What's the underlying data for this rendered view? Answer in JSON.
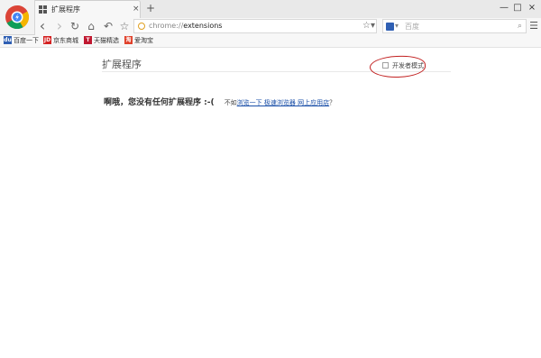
{
  "tab": {
    "title": "扩展程序",
    "close": "×"
  },
  "newtab": "+",
  "window": {
    "minimize": "—",
    "maximize": "□",
    "close": "×"
  },
  "nav": {
    "back": "‹",
    "forward": "›",
    "reload": "↻",
    "home": "⌂",
    "undo": "↶",
    "bookmark": "☆"
  },
  "address": {
    "prefix": "chrome://",
    "path": "extensions",
    "star": "☆▾"
  },
  "search": {
    "placeholder": "百度",
    "caret": "▾",
    "icon": "⌕"
  },
  "menu": "☰",
  "bookmarks": [
    {
      "icon": "du",
      "label": "百度一下",
      "color": "#2f5fb3"
    },
    {
      "icon": "JD",
      "label": "京东商城",
      "color": "#d42020"
    },
    {
      "icon": "T",
      "label": "天猫精选",
      "color": "#c01830"
    },
    {
      "icon": "淘",
      "label": "爱淘宝",
      "color": "#e0402a"
    }
  ],
  "page": {
    "title": "扩展程序",
    "devmode_label": "开发者模式",
    "empty_main": "啊哦，您没有任何扩展程序 :-(",
    "empty_pre": "不如",
    "empty_link": "浏览一下 极速浏览器 网上应用店",
    "empty_q": "？"
  },
  "colors": {
    "accent_link": "#1a4fa8",
    "highlight": "#c22020"
  }
}
